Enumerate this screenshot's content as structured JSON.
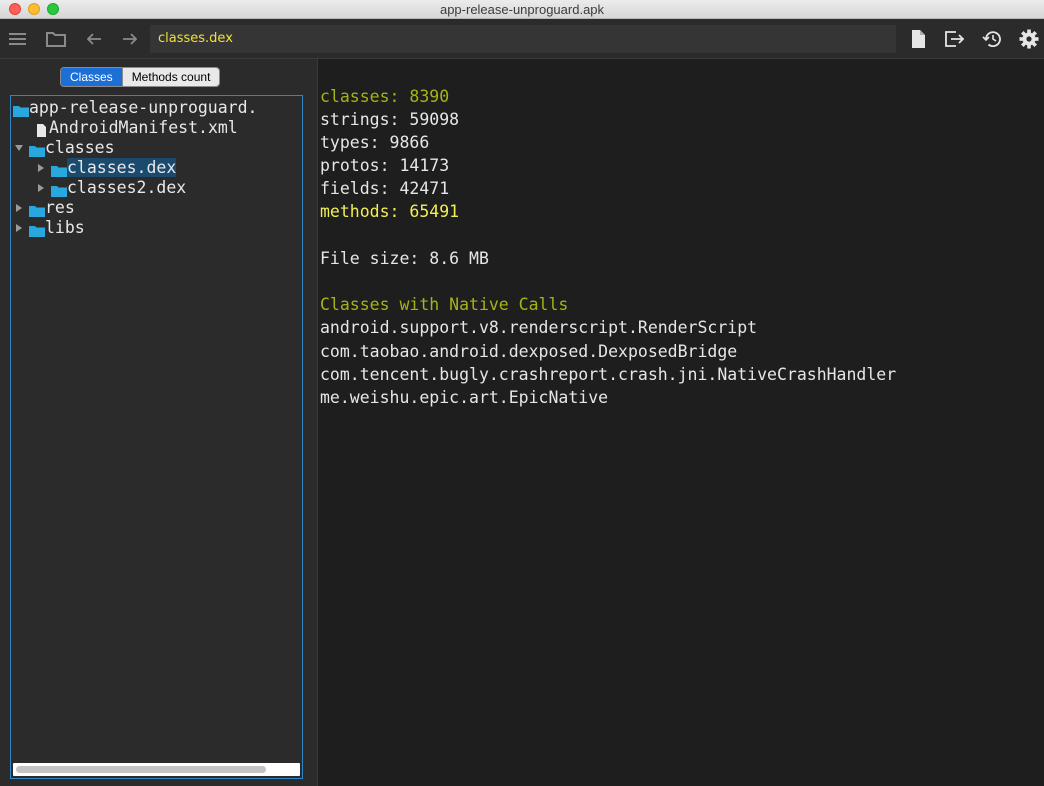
{
  "window": {
    "title": "app-release-unproguard.apk"
  },
  "toolbar": {
    "path": "classes.dex",
    "icons": [
      "menu-icon",
      "folder-icon",
      "back-arrow-icon",
      "forward-arrow-icon",
      "document-icon",
      "export-icon",
      "history-icon",
      "gear-icon"
    ]
  },
  "sidebar": {
    "tabs": [
      {
        "label": "Classes",
        "active": true
      },
      {
        "label": "Methods count",
        "active": false
      }
    ],
    "tree": [
      {
        "label": "app-release-unproguard.",
        "type": "folder",
        "depth": 0,
        "expanded": true
      },
      {
        "label": "AndroidManifest.xml",
        "type": "file",
        "depth": 1
      },
      {
        "label": "classes",
        "type": "folder",
        "depth": 0,
        "expanded": true
      },
      {
        "label": "classes.dex",
        "type": "folder",
        "depth": 1,
        "expanded": false,
        "selected": true
      },
      {
        "label": "classes2.dex",
        "type": "folder",
        "depth": 1,
        "expanded": false
      },
      {
        "label": "res",
        "type": "folder",
        "depth": 0,
        "expanded": false
      },
      {
        "label": "libs",
        "type": "folder",
        "depth": 0,
        "expanded": false
      }
    ]
  },
  "stats": {
    "classes": "classes: 8390",
    "strings": "strings: 59098",
    "types": "types: 9866",
    "protos": "protos: 14173",
    "fields": "fields: 42471",
    "methods": "methods: 65491",
    "file_size": "File size: 8.6 MB"
  },
  "native_calls": {
    "heading": "Classes with Native Calls",
    "items": [
      "android.support.v8.renderscript.RenderScript",
      "com.taobao.android.dexposed.DexposedBridge",
      "com.tencent.bugly.crashreport.crash.jni.NativeCrashHandler",
      "me.weishu.epic.art.EpicNative"
    ]
  },
  "colors": {
    "folder": "#29a8e0",
    "accent_olive": "#a5b315",
    "accent_yellow": "#f2ee55",
    "selection": "#1a4b6e",
    "tab_active": "#1c6fd6"
  }
}
